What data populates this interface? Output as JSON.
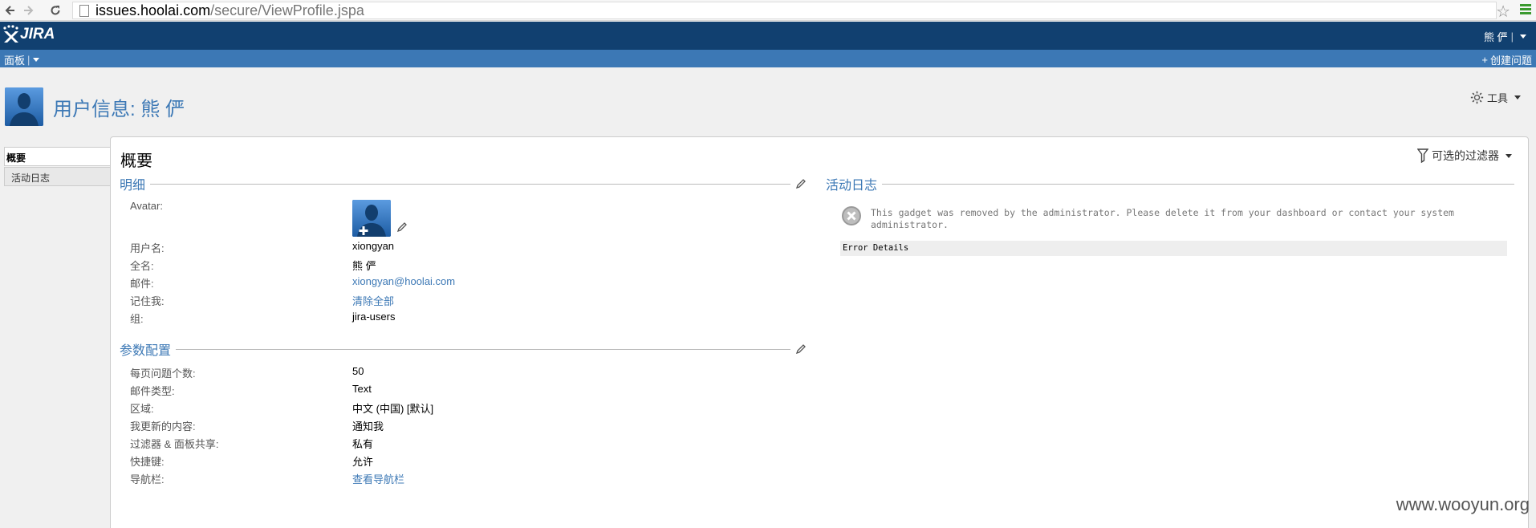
{
  "browser": {
    "url_host": "issues.hoolai.com",
    "url_path": "/secure/ViewProfile.jspa"
  },
  "header": {
    "logo_text": "JIRA",
    "user_name": "熊 俨"
  },
  "nav": {
    "dashboards": "面板",
    "create_issue": "创建问题"
  },
  "page": {
    "title": "用户信息: 熊 俨",
    "tools": "工具"
  },
  "tabs": {
    "summary": "概要",
    "activity": "活动日志"
  },
  "main": {
    "title": "概要",
    "filters": "可选的过滤器"
  },
  "details": {
    "heading": "明细",
    "avatar_label": "Avatar:",
    "username_label": "用户名:",
    "username": "xiongyan",
    "fullname_label": "全名:",
    "fullname": "熊 俨",
    "email_label": "邮件:",
    "email": "xiongyan@hoolai.com",
    "remember_label": "记住我:",
    "remember_value": "清除全部",
    "groups_label": "组:",
    "groups": "jira-users"
  },
  "preferences": {
    "heading": "参数配置",
    "page_size_label": "每页问题个数:",
    "page_size": "50",
    "email_type_label": "邮件类型:",
    "email_type": "Text",
    "locale_label": "区域:",
    "locale": "中文 (中国) [默认]",
    "my_changes_label": "我更新的内容:",
    "my_changes": "通知我",
    "sharing_label": "过滤器 & 面板共享:",
    "sharing": "私有",
    "shortcuts_label": "快捷键:",
    "shortcuts": "允许",
    "nav_label": "导航栏:",
    "nav_value": "查看导航栏"
  },
  "activity": {
    "heading": "活动日志",
    "error_message": "This gadget was removed by the administrator. Please delete it from your dashboard or contact your system administrator.",
    "error_details": "Error Details"
  },
  "watermark": "www.wooyun.org",
  "colors": {
    "header_bg": "#114070",
    "nav_bg": "#3c78b5",
    "link": "#3c78b5"
  }
}
